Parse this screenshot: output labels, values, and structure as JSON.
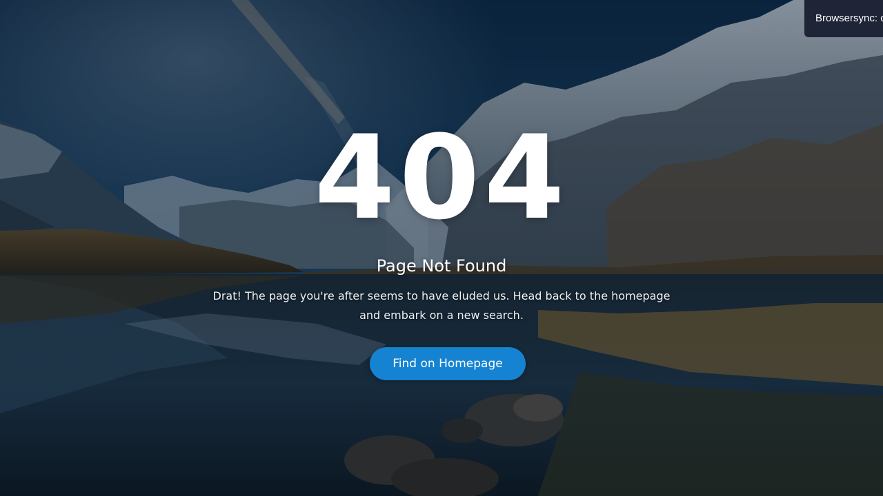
{
  "page": {
    "error_code": "404",
    "title": "Page Not Found",
    "description_line1": "Drat! The page you're after seems to have eluded us. Head back to the homepage",
    "description_line2": "and embark on a new search.",
    "cta_label": "Find on Homepage"
  },
  "browsersync": {
    "message": "Browsersync: c"
  },
  "colors": {
    "button": "#1583d1",
    "text": "#ffffff",
    "notification_bg": "#1f2536"
  },
  "icons": {
    "background": "mountain-lake-landscape"
  }
}
